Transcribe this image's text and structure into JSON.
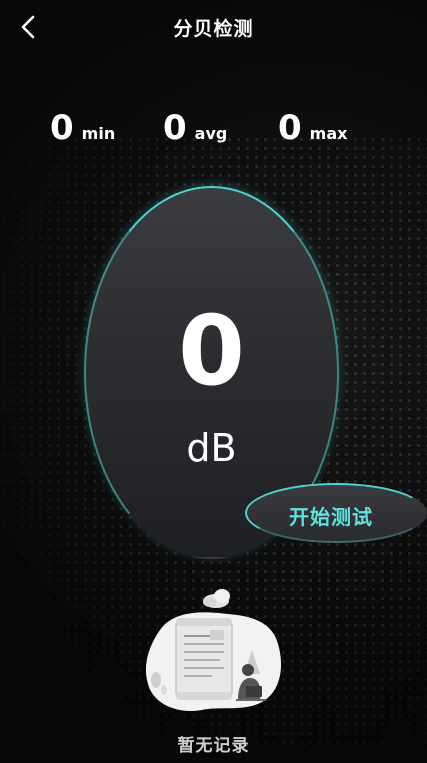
{
  "header": {
    "title": "分贝检测",
    "back_icon": "chevron-left-icon"
  },
  "stats": {
    "min": {
      "value": "0",
      "label": "min"
    },
    "avg": {
      "value": "0",
      "label": "avg"
    },
    "max": {
      "value": "0",
      "label": "max"
    }
  },
  "gauge": {
    "value": "0",
    "unit": "dB"
  },
  "start_button": {
    "label": "开始测试"
  },
  "empty_state": {
    "illustration": "empty-records-illustration",
    "text": "暂无记录"
  },
  "colors": {
    "background": "#070707",
    "accent": "#4fd3cf",
    "accent_text": "#5ee3df",
    "gauge_fill": "#2c2d31",
    "text": "#ffffff",
    "muted_text": "#cfcfcf"
  }
}
